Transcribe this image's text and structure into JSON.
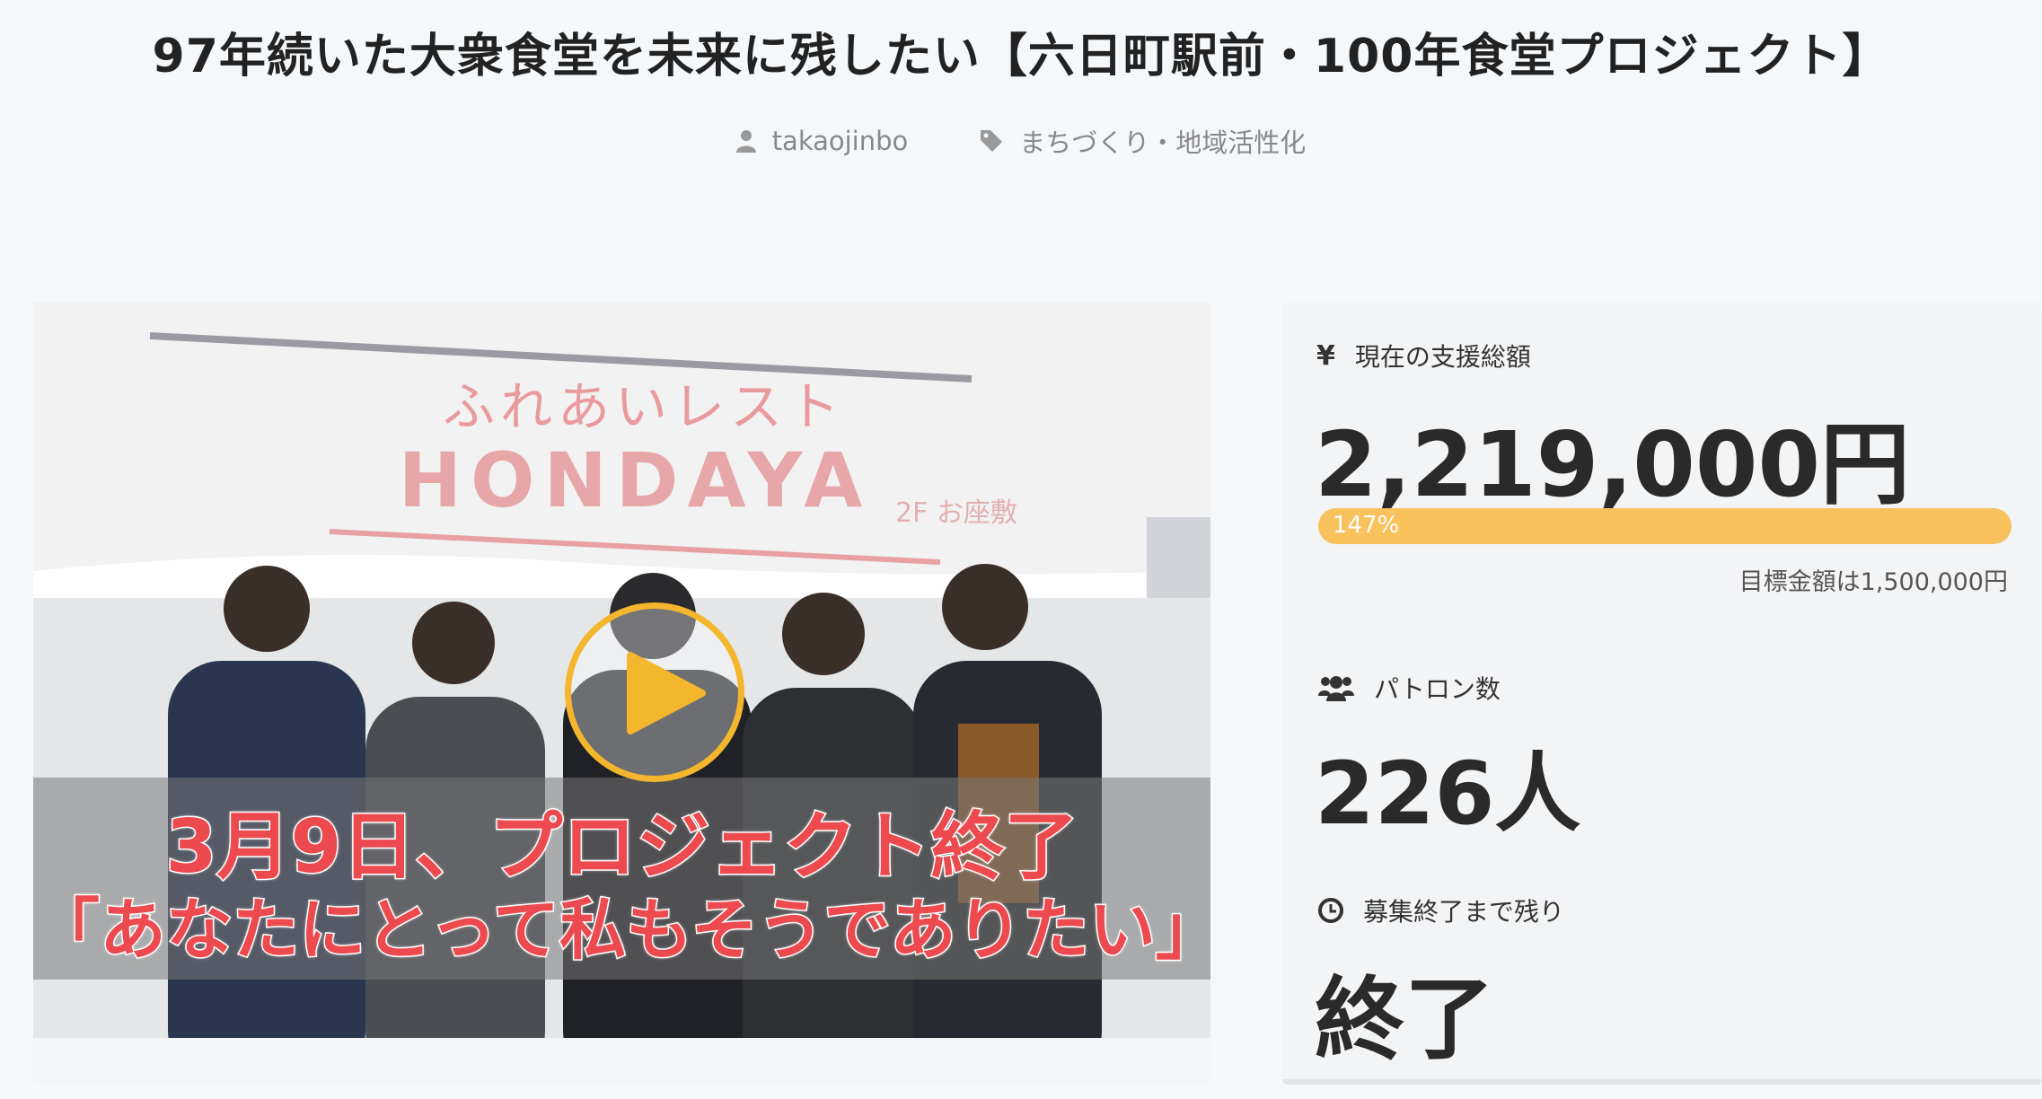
{
  "project": {
    "title": "97年続いた大衆食堂を未来に残したい【六日町駅前・100年食堂プロジェクト】",
    "author": "takaojinbo",
    "category": "まちづくり・地域活性化"
  },
  "video": {
    "sign_line1": "ふれあいレスト",
    "sign_line2": "HONDAYA",
    "sign_small": "2F お座敷",
    "caption_line1": "3月9日、プロジェクト終了",
    "caption_line2": "「あなたにとって私もそうでありたい」",
    "play_icon": "play-icon"
  },
  "stats": {
    "amount_label": "現在の支援総額",
    "amount_value": "2,219,000円",
    "progress_text": "147%",
    "progress_fraction": 1.47,
    "goal_text": "目標金額は1,500,000円",
    "patrons_label": "パトロン数",
    "patrons_value": "226人",
    "remaining_label": "募集終了まで残り",
    "remaining_value": "終了"
  },
  "colors": {
    "accent": "#f4b62c",
    "progress": "#f8c15c",
    "caption_red": "#ec4a4f"
  }
}
